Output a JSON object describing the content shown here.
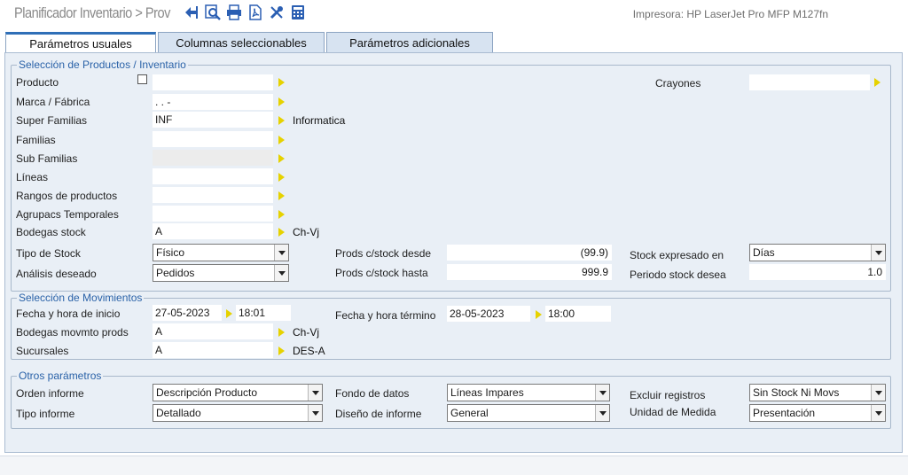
{
  "header": {
    "title": "Planificador Inventario > Prov",
    "printer": "Impresora: HP LaserJet Pro MFP M127fn",
    "toolbar_icons": [
      "exit-icon",
      "preview-icon",
      "print-icon",
      "pdf-icon",
      "tools-icon",
      "calculator-icon"
    ]
  },
  "tabs": [
    {
      "label": "Parámetros usuales"
    },
    {
      "label": "Columnas seleccionables"
    },
    {
      "label": "Parámetros adicionales"
    }
  ],
  "productos": {
    "title": "Selección de Productos / Inventario",
    "producto_label": "Producto",
    "marca_label": "Marca / Fábrica",
    "marca_value": ".   .   -",
    "super_label": "Super Familias",
    "super_value": "INF",
    "super_desc": "Informatica",
    "familias_label": "Familias",
    "subfamilias_label": "Sub Familias",
    "lineas_label": "Líneas",
    "rangos_label": "Rangos de productos",
    "agrupacs_label": "Agrupacs Temporales",
    "bodegas_label": "Bodegas stock",
    "bodegas_value": "A",
    "bodegas_desc": "Ch-Vj",
    "crayones_label": "Crayones",
    "tipo_stock_label": "Tipo de Stock",
    "tipo_stock_value": "Físico",
    "analisis_label": "Análisis deseado",
    "analisis_value": "Pedidos",
    "desde_label": "Prods c/stock desde",
    "desde_value": "(99.9)",
    "hasta_label": "Prods c/stock hasta",
    "hasta_value": "999.9",
    "expresado_label": "Stock expresado en",
    "expresado_value": "Días",
    "periodo_label": "Periodo stock desea",
    "periodo_value": "1.0"
  },
  "movimientos": {
    "title": "Selección de Movimientos",
    "inicio_label": "Fecha y hora de inicio",
    "inicio_fecha": "27-05-2023",
    "inicio_hora": "18:01",
    "termino_label": "Fecha y hora término",
    "termino_fecha": "28-05-2023",
    "termino_hora": "18:00",
    "bodegas_label": "Bodegas movmto prods",
    "bodegas_value": "A",
    "bodegas_desc": "Ch-Vj",
    "sucursales_label": "Sucursales",
    "sucursales_value": "A",
    "sucursales_desc": "DES-A"
  },
  "otros": {
    "title": "Otros parámetros",
    "orden_label": "Orden informe",
    "orden_value": "Descripción Producto",
    "tipo_label": "Tipo informe",
    "tipo_value": "Detallado",
    "fondo_label": "Fondo de datos",
    "fondo_value": "Líneas Impares",
    "diseno_label": "Diseño de informe",
    "diseno_value": "General",
    "excluir_label": "Excluir registros",
    "excluir_value": "Sin Stock Ni Movs",
    "unidad_label": "Unidad de Medida",
    "unidad_value": "Presentación"
  },
  "colors": {
    "accent": "#2f6fb7",
    "group_title": "#2a62a8",
    "panel_bg": "#e9eff6",
    "lookup_arrow": "#e6d200"
  }
}
